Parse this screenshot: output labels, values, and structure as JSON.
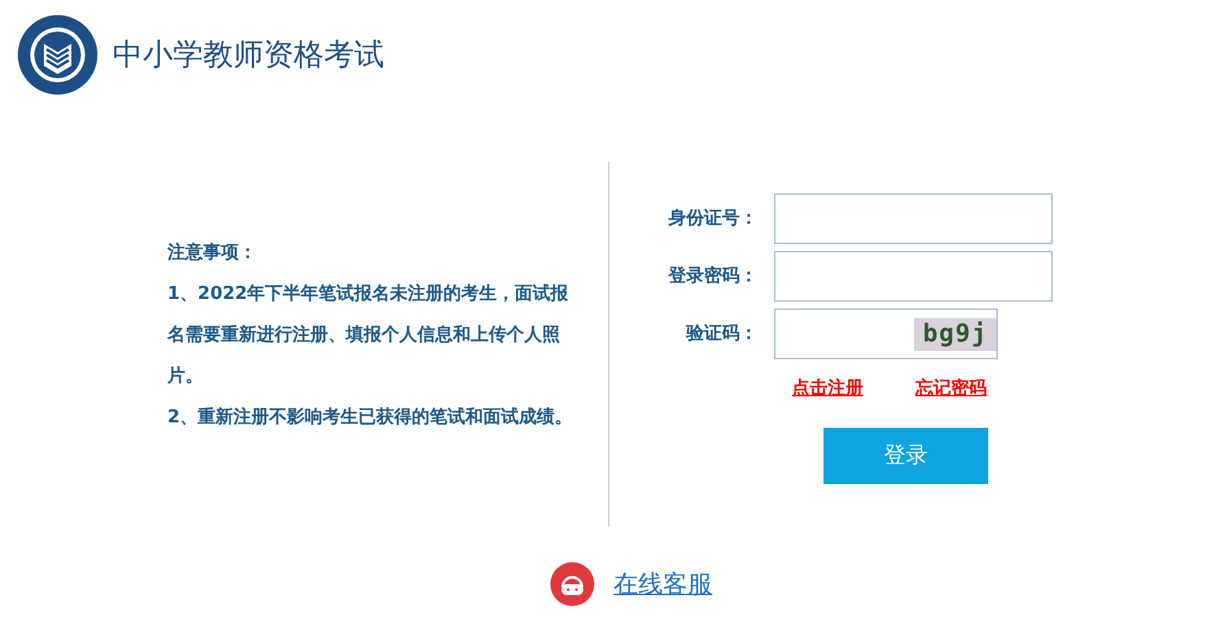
{
  "header": {
    "title": "中小学教师资格考试"
  },
  "notice": {
    "heading": "注意事项：",
    "items": [
      "1、2022年下半年笔试报名未注册的考生，面试报名需要重新进行注册、填报个人信息和上传个人照片。",
      "2、重新注册不影响考生已获得的笔试和面试成绩。"
    ]
  },
  "form": {
    "fields": [
      {
        "label": "身份证号：",
        "kind": "text"
      },
      {
        "label": "登录密码：",
        "kind": "password"
      },
      {
        "label": "验证码：",
        "kind": "captcha",
        "captcha": "bg9j"
      }
    ],
    "links": [
      "点击注册",
      "忘记密码"
    ],
    "submit": "登录"
  },
  "support": {
    "label": "在线客服"
  }
}
